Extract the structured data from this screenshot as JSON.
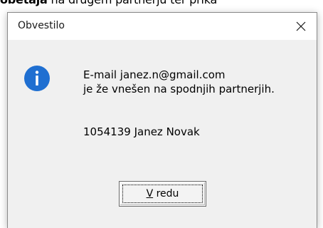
{
  "background": {
    "text_bold": "obetaja",
    "text_rest": " na drugem partnerju ter prika"
  },
  "dialog": {
    "title": "Obvestilo",
    "close_glyph": "✕",
    "icon": "info-icon",
    "message_line1": "E-mail janez.n@gmail.com",
    "message_line2": "je že vnešen na spodnjih partnerjih.",
    "partner_entry": "1054139 Janez Novak",
    "ok_button": {
      "accel_char": "V",
      "rest": " redu"
    }
  },
  "colors": {
    "dialog_bg": "#f0f0f0",
    "titlebar_bg": "#ffffff",
    "info_icon": "#1f6fd1"
  }
}
